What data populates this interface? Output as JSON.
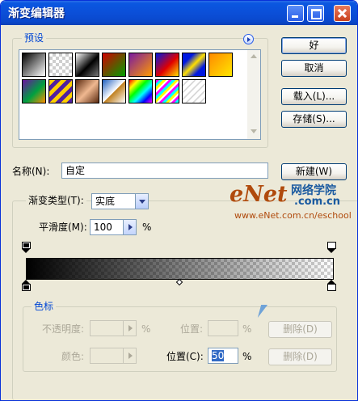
{
  "window": {
    "title": "渐变编辑器"
  },
  "presets": {
    "label": "预设",
    "swatch_names": [
      "black-white",
      "transparent-checker",
      "black-white-2",
      "red-green",
      "violet-orange",
      "blue-red-yellow",
      "blue-yellow-blue",
      "orange-yellow",
      "violet-green-orange",
      "yellow-violet-stripes",
      "copper",
      "chrome",
      "spectrum",
      "rainbow-transparent",
      "transparent-stripes"
    ]
  },
  "buttons": {
    "ok": "好",
    "cancel": "取消",
    "load": "载入(L)...",
    "save": "存储(S)...",
    "new": "新建(W)",
    "delete_opacity": "删除(D)",
    "delete_color": "删除(D)"
  },
  "name_field": {
    "label": "名称(N):",
    "value": "自定"
  },
  "gradient_type": {
    "label": "渐变类型(T):",
    "value": "实底"
  },
  "smoothness": {
    "label": "平滑度(M):",
    "value": "100",
    "unit": "%"
  },
  "stops": {
    "label": "色标",
    "opacity_label": "不透明度:",
    "opacity_unit": "%",
    "opacity_location_label": "位置:",
    "opacity_location_unit": "%",
    "color_label": "颜色:",
    "color_location_label": "位置(C):",
    "color_location_value": "50",
    "color_location_unit": "%"
  },
  "watermark": {
    "logo_text": "eNet",
    "logo_suffix": "网络学院",
    "logo_domain": ".com.cn",
    "url": "www.eNet.com.cn/eschool"
  },
  "colors": {
    "accent": "#0046d5",
    "title_bar": "#0b4fd8",
    "dialog_bg": "#ece9d8"
  }
}
